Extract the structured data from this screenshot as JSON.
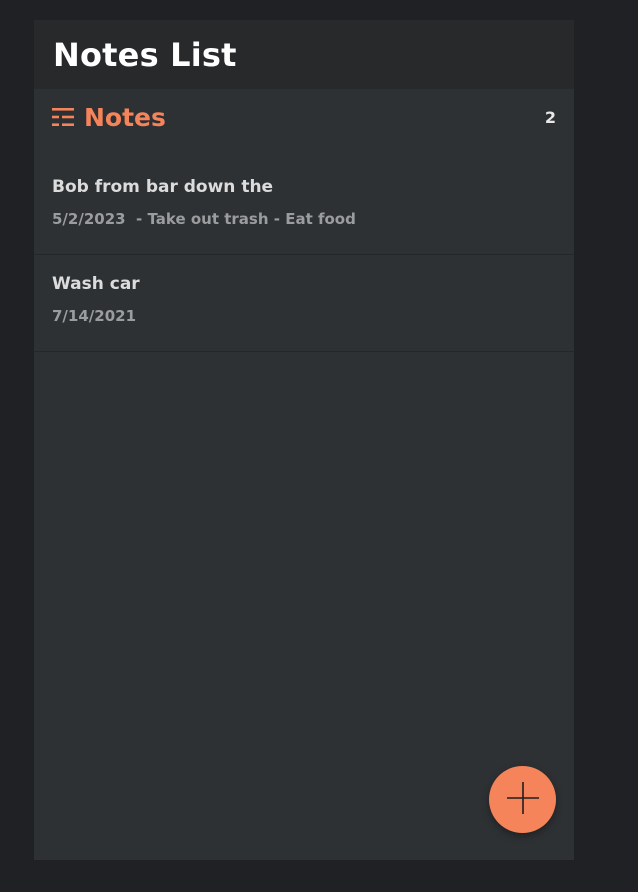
{
  "header": {
    "title": "Notes List"
  },
  "section": {
    "title": "Notes",
    "icon": "notes-list-icon",
    "count": "2"
  },
  "notes": [
    {
      "title": "Bob from bar down the",
      "meta": "5/2/2023  - Take out trash - Eat food"
    },
    {
      "title": "Wash car",
      "meta": "7/14/2021"
    }
  ],
  "fab": {
    "icon": "plus-icon"
  },
  "colors": {
    "accent": "#f5845a",
    "background": "#202124",
    "panel": "#2e3134",
    "header": "#27292b"
  }
}
